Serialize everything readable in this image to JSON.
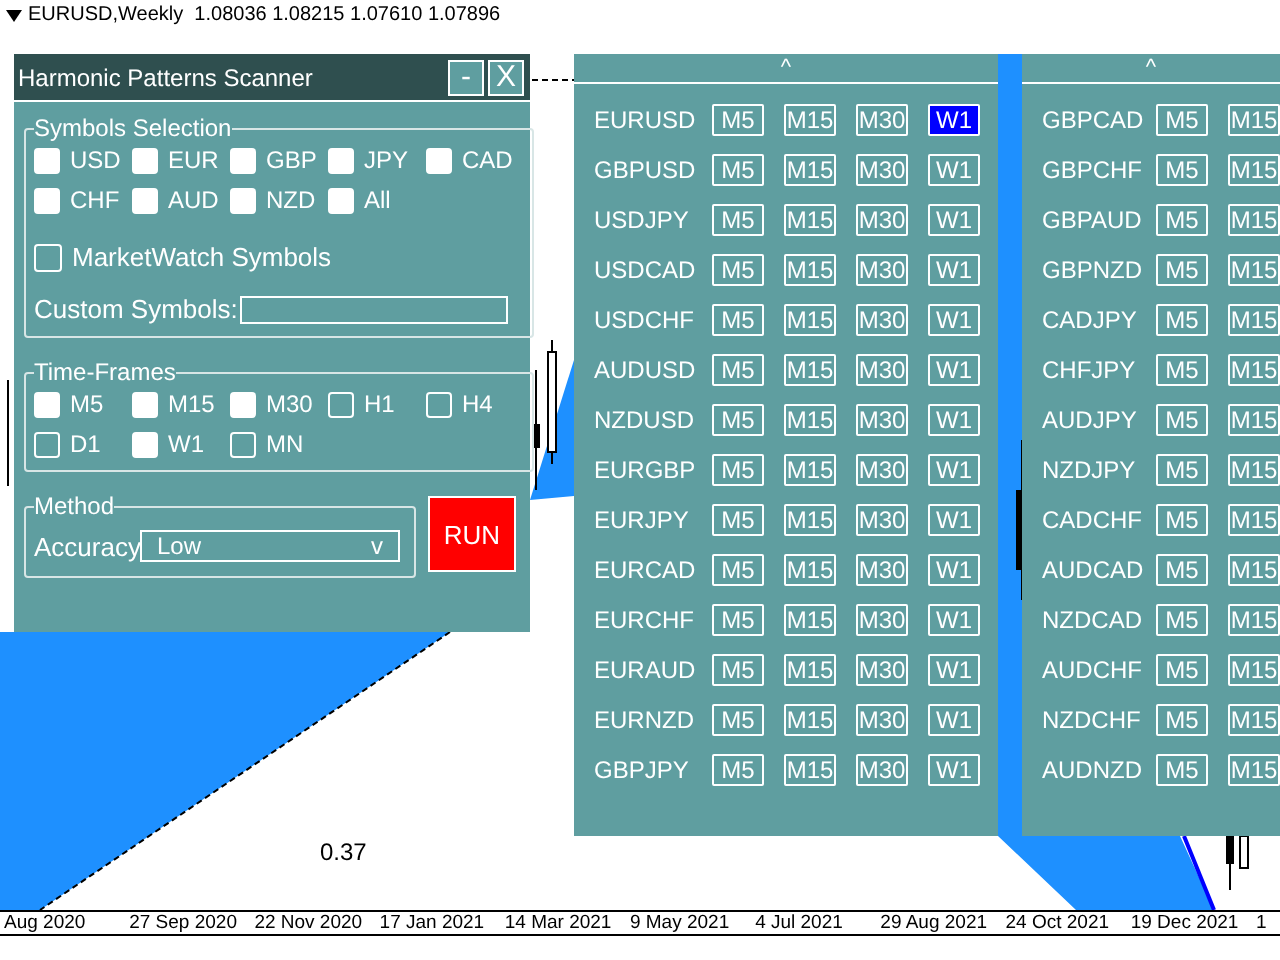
{
  "chart": {
    "header": "EURUSD,Weekly  1.08036 1.08215 1.07610 1.07896",
    "level_label": "0.37",
    "x_labels": [
      "Aug 2020",
      "27 Sep 2020",
      "22 Nov 2020",
      "17 Jan 2021",
      "14 Mar 2021",
      "9 May 2021",
      "4 Jul 2021",
      "29 Aug 2021",
      "24 Oct 2021",
      "19 Dec 2021",
      "1"
    ]
  },
  "scanner": {
    "title": "Harmonic Patterns Scanner",
    "window_buttons": [
      "-",
      "X"
    ],
    "symbols_selection": {
      "title": "Symbols Selection",
      "currencies": [
        {
          "label": "USD",
          "checked": true
        },
        {
          "label": "EUR",
          "checked": true
        },
        {
          "label": "GBP",
          "checked": true
        },
        {
          "label": "JPY",
          "checked": true
        },
        {
          "label": "CAD",
          "checked": true
        },
        {
          "label": "CHF",
          "checked": true
        },
        {
          "label": "AUD",
          "checked": true
        },
        {
          "label": "NZD",
          "checked": true
        },
        {
          "label": "All",
          "checked": true
        }
      ],
      "marketwatch": {
        "label": "MarketWatch Symbols",
        "checked": false
      },
      "custom_symbols": {
        "label": "Custom Symbols:"
      }
    },
    "time_frames": {
      "title": "Time-Frames",
      "items": [
        {
          "label": "M5",
          "checked": true
        },
        {
          "label": "M15",
          "checked": true
        },
        {
          "label": "M30",
          "checked": true
        },
        {
          "label": "H1",
          "checked": false
        },
        {
          "label": "H4",
          "checked": false
        },
        {
          "label": "D1",
          "checked": false
        },
        {
          "label": "W1",
          "checked": true
        },
        {
          "label": "MN",
          "checked": false
        }
      ]
    },
    "method": {
      "title": "Method",
      "accuracy_label": "Accuracy",
      "accuracy_value": "Low",
      "dropdown_caret": "v"
    },
    "run_button": "RUN"
  },
  "result_panels": [
    {
      "collapse": "^",
      "rows": [
        {
          "symbol": "EURUSD",
          "timeframes": [
            {
              "label": "M5",
              "selected": false
            },
            {
              "label": "M15",
              "selected": false
            },
            {
              "label": "M30",
              "selected": false
            },
            {
              "label": "W1",
              "selected": true
            }
          ]
        },
        {
          "symbol": "GBPUSD",
          "timeframes": [
            {
              "label": "M5",
              "selected": false
            },
            {
              "label": "M15",
              "selected": false
            },
            {
              "label": "M30",
              "selected": false
            },
            {
              "label": "W1",
              "selected": false
            }
          ]
        },
        {
          "symbol": "USDJPY",
          "timeframes": [
            {
              "label": "M5",
              "selected": false
            },
            {
              "label": "M15",
              "selected": false
            },
            {
              "label": "M30",
              "selected": false
            },
            {
              "label": "W1",
              "selected": false
            }
          ]
        },
        {
          "symbol": "USDCAD",
          "timeframes": [
            {
              "label": "M5",
              "selected": false
            },
            {
              "label": "M15",
              "selected": false
            },
            {
              "label": "M30",
              "selected": false
            },
            {
              "label": "W1",
              "selected": false
            }
          ]
        },
        {
          "symbol": "USDCHF",
          "timeframes": [
            {
              "label": "M5",
              "selected": false
            },
            {
              "label": "M15",
              "selected": false
            },
            {
              "label": "M30",
              "selected": false
            },
            {
              "label": "W1",
              "selected": false
            }
          ]
        },
        {
          "symbol": "AUDUSD",
          "timeframes": [
            {
              "label": "M5",
              "selected": false
            },
            {
              "label": "M15",
              "selected": false
            },
            {
              "label": "M30",
              "selected": false
            },
            {
              "label": "W1",
              "selected": false
            }
          ]
        },
        {
          "symbol": "NZDUSD",
          "timeframes": [
            {
              "label": "M5",
              "selected": false
            },
            {
              "label": "M15",
              "selected": false
            },
            {
              "label": "M30",
              "selected": false
            },
            {
              "label": "W1",
              "selected": false
            }
          ]
        },
        {
          "symbol": "EURGBP",
          "timeframes": [
            {
              "label": "M5",
              "selected": false
            },
            {
              "label": "M15",
              "selected": false
            },
            {
              "label": "M30",
              "selected": false
            },
            {
              "label": "W1",
              "selected": false
            }
          ]
        },
        {
          "symbol": "EURJPY",
          "timeframes": [
            {
              "label": "M5",
              "selected": false
            },
            {
              "label": "M15",
              "selected": false
            },
            {
              "label": "M30",
              "selected": false
            },
            {
              "label": "W1",
              "selected": false
            }
          ]
        },
        {
          "symbol": "EURCAD",
          "timeframes": [
            {
              "label": "M5",
              "selected": false
            },
            {
              "label": "M15",
              "selected": false
            },
            {
              "label": "M30",
              "selected": false
            },
            {
              "label": "W1",
              "selected": false
            }
          ]
        },
        {
          "symbol": "EURCHF",
          "timeframes": [
            {
              "label": "M5",
              "selected": false
            },
            {
              "label": "M15",
              "selected": false
            },
            {
              "label": "M30",
              "selected": false
            },
            {
              "label": "W1",
              "selected": false
            }
          ]
        },
        {
          "symbol": "EURAUD",
          "timeframes": [
            {
              "label": "M5",
              "selected": false
            },
            {
              "label": "M15",
              "selected": false
            },
            {
              "label": "M30",
              "selected": false
            },
            {
              "label": "W1",
              "selected": false
            }
          ]
        },
        {
          "symbol": "EURNZD",
          "timeframes": [
            {
              "label": "M5",
              "selected": false
            },
            {
              "label": "M15",
              "selected": false
            },
            {
              "label": "M30",
              "selected": false
            },
            {
              "label": "W1",
              "selected": false
            }
          ]
        },
        {
          "symbol": "GBPJPY",
          "timeframes": [
            {
              "label": "M5",
              "selected": false
            },
            {
              "label": "M15",
              "selected": false
            },
            {
              "label": "M30",
              "selected": false
            },
            {
              "label": "W1",
              "selected": false
            }
          ]
        }
      ]
    },
    {
      "collapse": "^",
      "rows": [
        {
          "symbol": "GBPCAD",
          "timeframes": [
            {
              "label": "M5",
              "selected": false
            },
            {
              "label": "M15",
              "selected": false
            }
          ]
        },
        {
          "symbol": "GBPCHF",
          "timeframes": [
            {
              "label": "M5",
              "selected": false
            },
            {
              "label": "M15",
              "selected": false
            }
          ]
        },
        {
          "symbol": "GBPAUD",
          "timeframes": [
            {
              "label": "M5",
              "selected": false
            },
            {
              "label": "M15",
              "selected": false
            }
          ]
        },
        {
          "symbol": "GBPNZD",
          "timeframes": [
            {
              "label": "M5",
              "selected": false
            },
            {
              "label": "M15",
              "selected": false
            }
          ]
        },
        {
          "symbol": "CADJPY",
          "timeframes": [
            {
              "label": "M5",
              "selected": false
            },
            {
              "label": "M15",
              "selected": false
            }
          ]
        },
        {
          "symbol": "CHFJPY",
          "timeframes": [
            {
              "label": "M5",
              "selected": false
            },
            {
              "label": "M15",
              "selected": false
            }
          ]
        },
        {
          "symbol": "AUDJPY",
          "timeframes": [
            {
              "label": "M5",
              "selected": false
            },
            {
              "label": "M15",
              "selected": false
            }
          ]
        },
        {
          "symbol": "NZDJPY",
          "timeframes": [
            {
              "label": "M5",
              "selected": false
            },
            {
              "label": "M15",
              "selected": false
            }
          ]
        },
        {
          "symbol": "CADCHF",
          "timeframes": [
            {
              "label": "M5",
              "selected": false
            },
            {
              "label": "M15",
              "selected": false
            }
          ]
        },
        {
          "symbol": "AUDCAD",
          "timeframes": [
            {
              "label": "M5",
              "selected": false
            },
            {
              "label": "M15",
              "selected": false
            }
          ]
        },
        {
          "symbol": "NZDCAD",
          "timeframes": [
            {
              "label": "M5",
              "selected": false
            },
            {
              "label": "M15",
              "selected": false
            }
          ]
        },
        {
          "symbol": "AUDCHF",
          "timeframes": [
            {
              "label": "M5",
              "selected": false
            },
            {
              "label": "M15",
              "selected": false
            }
          ]
        },
        {
          "symbol": "NZDCHF",
          "timeframes": [
            {
              "label": "M5",
              "selected": false
            },
            {
              "label": "M15",
              "selected": false
            }
          ]
        },
        {
          "symbol": "AUDNZD",
          "timeframes": [
            {
              "label": "M5",
              "selected": false
            },
            {
              "label": "M15",
              "selected": false
            }
          ]
        }
      ]
    }
  ]
}
